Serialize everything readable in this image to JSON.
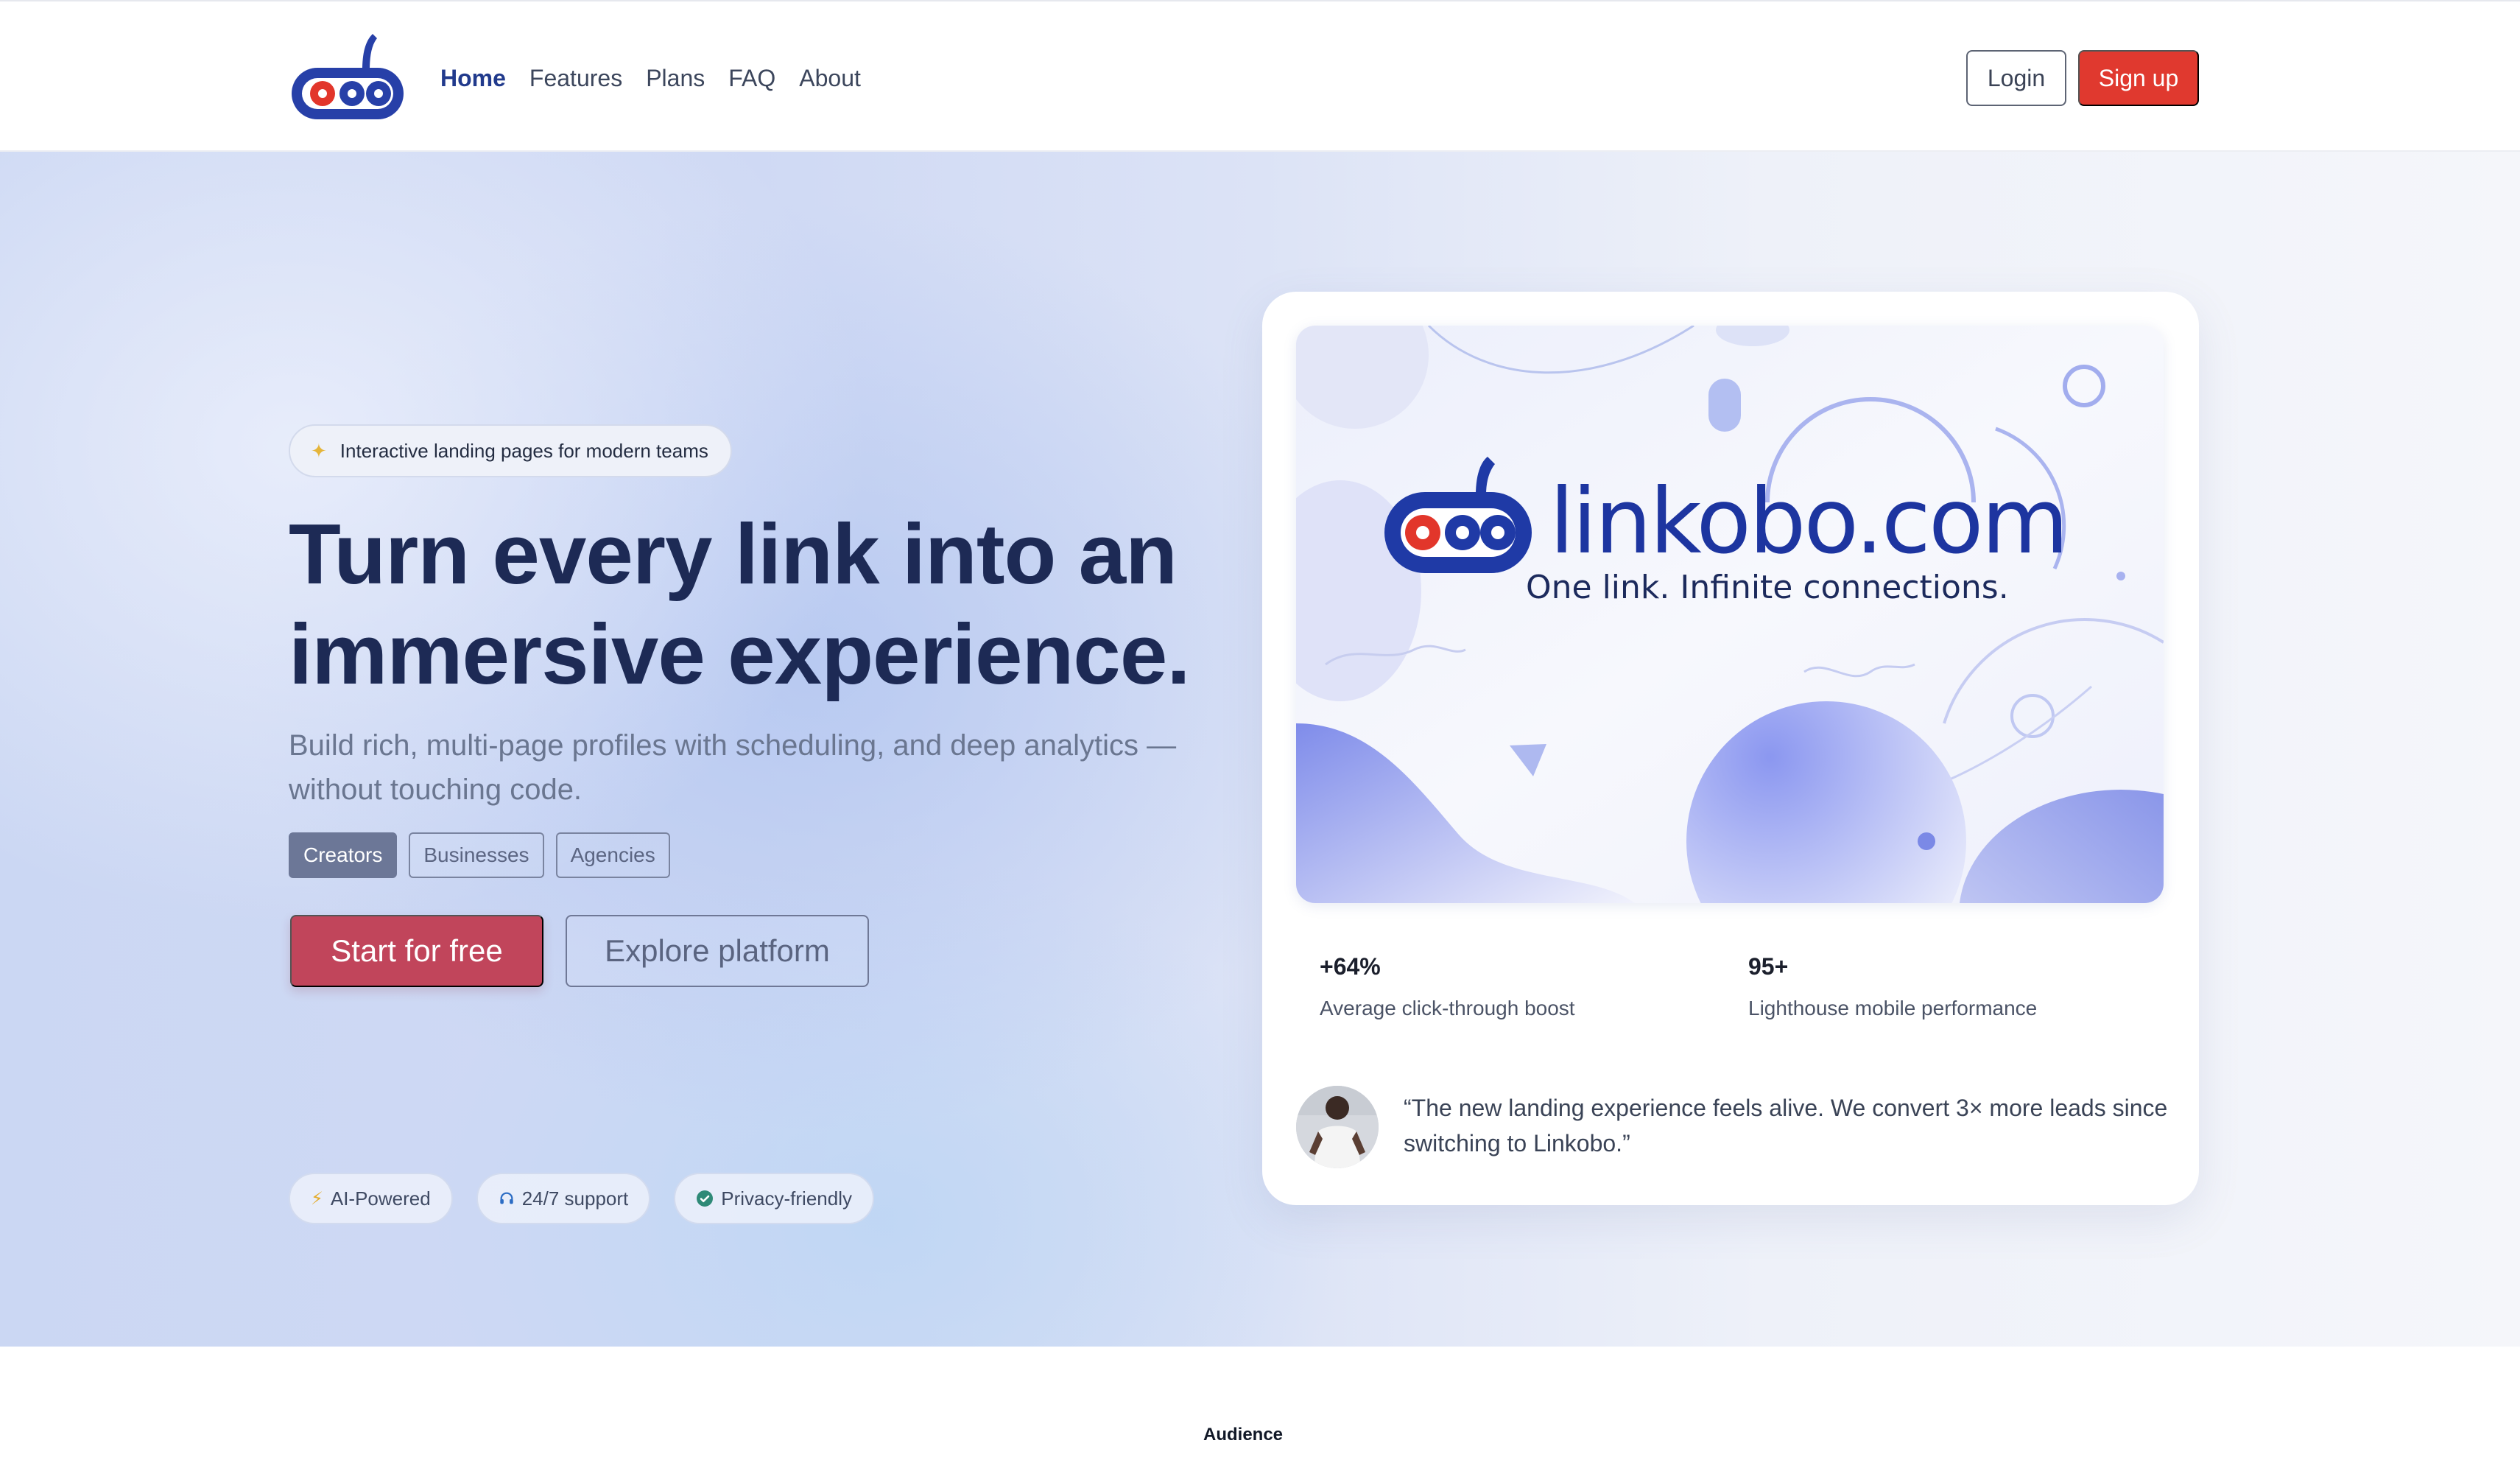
{
  "header": {
    "logo_icon": "linkobo-logo-icon",
    "nav": [
      {
        "label": "Home",
        "active": true
      },
      {
        "label": "Features",
        "active": false
      },
      {
        "label": "Plans",
        "active": false
      },
      {
        "label": "FAQ",
        "active": false
      },
      {
        "label": "About",
        "active": false
      }
    ],
    "login_label": "Login",
    "signup_label": "Sign up"
  },
  "hero": {
    "eyebrow_icon": "sparkle-icon",
    "eyebrow": "Interactive landing pages for modern teams",
    "headline_line1": "Turn every link into an",
    "headline_line2": "immersive experience.",
    "subhead": "Build rich, multi-page profiles with scheduling, and deep analytics — without touching code.",
    "segments": [
      {
        "label": "Creators",
        "active": true
      },
      {
        "label": "Businesses",
        "active": false
      },
      {
        "label": "Agencies",
        "active": false
      }
    ],
    "primary_cta": "Start for free",
    "secondary_cta": "Explore platform",
    "features": [
      {
        "icon": "bolt-icon",
        "label": "AI-Powered"
      },
      {
        "icon": "headset-icon",
        "label": "24/7 support"
      },
      {
        "icon": "check-circle-icon",
        "label": "Privacy-friendly"
      }
    ]
  },
  "card": {
    "banner": {
      "brand_name": "linkobo.com",
      "tagline": "One link. Infinite connections."
    },
    "stats": [
      {
        "value": "+64%",
        "label": "Average click-through boost"
      },
      {
        "value": "95+",
        "label": "Lighthouse mobile performance"
      }
    ],
    "testimonial": {
      "avatar_icon": "avatar-photo",
      "quote": "“The new landing experience feels alive. We convert 3× more leads since switching to Linkobo.”"
    }
  },
  "section_label": "Audience",
  "colors": {
    "brand_blue": "#213a8c",
    "signup_red": "#e0392f",
    "cta_rose": "#c1455b",
    "headline": "#1d2a55"
  }
}
